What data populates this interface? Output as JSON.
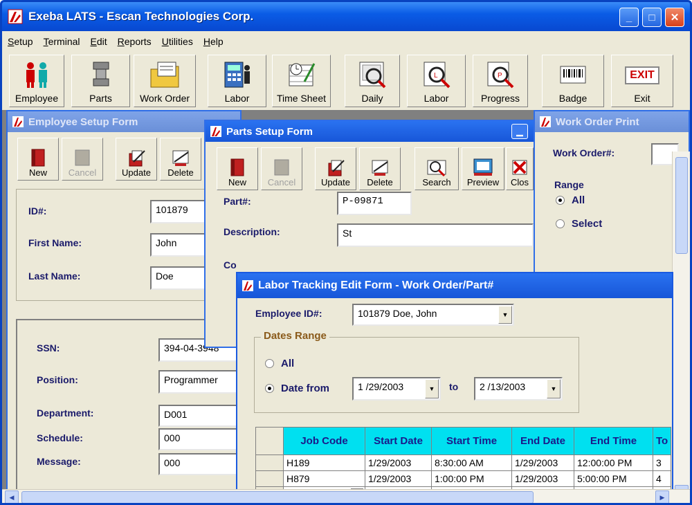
{
  "window": {
    "title": "Exeba LATS - Escan Technologies Corp."
  },
  "menu": {
    "items": [
      {
        "first": "S",
        "rest": "etup"
      },
      {
        "first": "T",
        "rest": "erminal"
      },
      {
        "first": "E",
        "rest": "dit"
      },
      {
        "first": "R",
        "rest": "eports"
      },
      {
        "first": "U",
        "rest": "tilities"
      },
      {
        "first": "H",
        "rest": "elp"
      }
    ]
  },
  "toolbar": {
    "employee": "Employee",
    "parts": "Parts",
    "work_order": "Work Order",
    "labor": "Labor",
    "time_sheet": "Time Sheet",
    "daily": "Daily",
    "labor_report": "Labor",
    "progress": "Progress",
    "badge": "Badge",
    "exit": "Exit",
    "exit_sign": "EXIT"
  },
  "employee_form": {
    "title": "Employee Setup Form",
    "buttons": {
      "new": "New",
      "cancel": "Cancel",
      "update": "Update",
      "delete": "Delete"
    },
    "labels": {
      "id": "ID#:",
      "first_name": "First Name:",
      "last_name": "Last Name:",
      "ssn": "SSN:",
      "position": "Position:",
      "department": "Department:",
      "schedule": "Schedule:",
      "message": "Message:"
    },
    "values": {
      "id": "101879",
      "first_name": "John",
      "last_name": "Doe",
      "ssn": "394-04-3948",
      "position": "Programmer",
      "department": "D001",
      "schedule": "000",
      "message": "000"
    }
  },
  "parts_form": {
    "title": "Parts Setup Form",
    "buttons": {
      "new": "New",
      "cancel": "Cancel",
      "update": "Update",
      "delete": "Delete",
      "search": "Search",
      "preview": "Preview",
      "close": "Clos"
    },
    "labels": {
      "part": "Part#:",
      "description": "Description:",
      "co": "Co"
    },
    "values": {
      "part": "P-09871",
      "description": "St"
    }
  },
  "work_order_form": {
    "title": "Work Order Print",
    "labels": {
      "work_order": "Work Order#:",
      "range": "Range",
      "all": "All",
      "select": "Select"
    }
  },
  "labor_form": {
    "title": "Labor Tracking Edit Form - Work Order/Part#",
    "labels": {
      "employee_id": "Employee ID#:",
      "dates_range": "Dates Range",
      "all": "All",
      "date_from": "Date from",
      "to": "to"
    },
    "values": {
      "employee": "101879 Doe, John",
      "date_from": "1 /29/2003",
      "date_to": "2 /13/2003"
    },
    "grid": {
      "headers": [
        "Job Code",
        "Start Date",
        "Start Time",
        "End Date",
        "End Time",
        "To"
      ],
      "rows": [
        [
          "H189",
          "1/29/2003",
          "8:30:00 AM",
          "1/29/2003",
          "12:00:00 PM",
          "3"
        ],
        [
          "H879",
          "1/29/2003",
          "1:00:00 PM",
          "1/29/2003",
          "5:00:00 PM",
          "4"
        ]
      ],
      "new_row_marker": "✱"
    }
  }
}
